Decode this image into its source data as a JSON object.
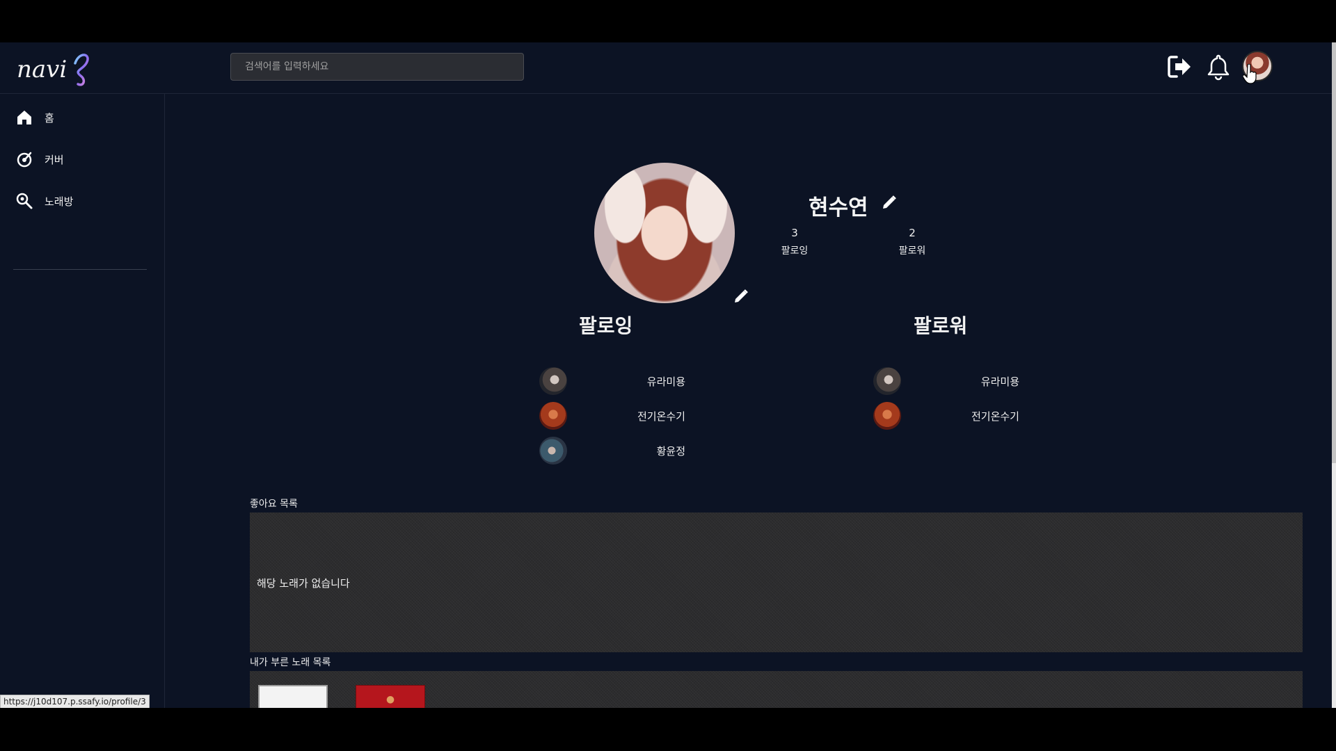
{
  "header": {
    "logo_text": "navi",
    "search_placeholder": "검색어를 입력하세요"
  },
  "sidebar": {
    "items": [
      {
        "label": "홈",
        "icon": "home-icon"
      },
      {
        "label": "커버",
        "icon": "cover-icon"
      },
      {
        "label": "노래방",
        "icon": "search-mic-icon"
      }
    ]
  },
  "profile": {
    "name": "현수연",
    "following_count": "3",
    "following_label": "팔로잉",
    "follower_count": "2",
    "follower_label": "팔로워"
  },
  "following_section": {
    "title": "팔로잉",
    "users": [
      "유라미용",
      "전기온수기",
      "황윤정"
    ]
  },
  "follower_section": {
    "title": "팔로워",
    "users": [
      "유라미용",
      "전기온수기"
    ]
  },
  "liked_list": {
    "label": "좋아요 목록",
    "empty_message": "해당 노래가 없습니다"
  },
  "sung_list": {
    "label": "내가 부른 노래 목록"
  },
  "status_bar": {
    "url": "https://j10d107.p.ssafy.io/profile/3"
  },
  "colors": {
    "background": "#0c1324",
    "panel": "#2c2c2e",
    "accent": "#6b5cd8"
  }
}
